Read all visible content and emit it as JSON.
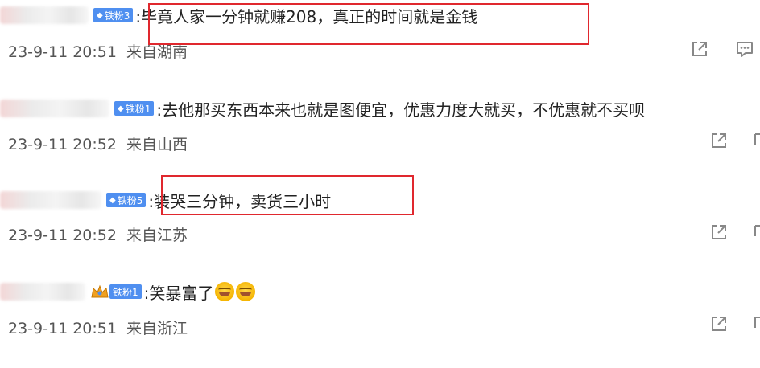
{
  "colors": {
    "badge_blue": "#4f8ff0",
    "highlight_red": "#e0282e",
    "meta_gray": "#555555",
    "text_dark": "#222222"
  },
  "comments": [
    {
      "badge": "铁粉3",
      "text": ":毕竟人家一分钟就赚208，真正的时间就是金钱",
      "date": "23-9-11 20:51",
      "location": "来自湖南",
      "highlighted": true
    },
    {
      "badge": "铁粉1",
      "text": ":去他那买东西本来也就是图便宜，优惠力度大就买，不优惠就不买呗",
      "date": "23-9-11 20:52",
      "location": "来自山西",
      "highlighted": false
    },
    {
      "badge": "铁粉5",
      "text": ":装哭三分钟，卖货三小时",
      "date": "23-9-11 20:52",
      "location": "来自江苏",
      "highlighted": true
    },
    {
      "badge": "铁粉1",
      "text": ":笑暴富了",
      "date": "23-9-11 20:51",
      "location": "来自浙江",
      "highlighted": false,
      "emoji": [
        "laughing-tears-emoji",
        "laughing-tears-emoji"
      ]
    }
  ],
  "icons": {
    "share": "share-icon",
    "comment": "comment-icon",
    "badge_diamond": "diamond-icon",
    "crown": "crown-icon"
  }
}
